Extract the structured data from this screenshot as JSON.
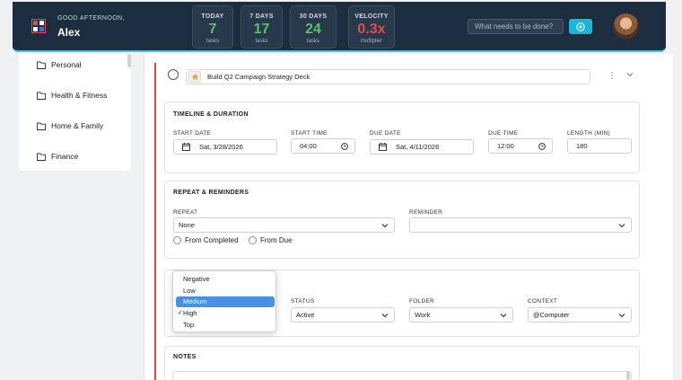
{
  "header": {
    "greeting": "GOOD AFTERNOON,",
    "name": "Alex",
    "search_placeholder": "What needs to be done?",
    "stats": [
      {
        "label": "TODAY",
        "value": "7",
        "sub": "tasks"
      },
      {
        "label": "7 DAYS",
        "value": "17",
        "sub": "tasks"
      },
      {
        "label": "30 DAYS",
        "value": "24",
        "sub": "tasks"
      },
      {
        "label": "VELOCITY",
        "value": "0.3x",
        "sub": "multiplier"
      }
    ],
    "colors": {
      "bar": "#1c2d3f",
      "accent": "#1ab7d9",
      "good": "#56c06c",
      "bad": "#e64b4b"
    }
  },
  "sidebar": {
    "items": [
      {
        "label": "Personal",
        "icon": "folder-icon"
      },
      {
        "label": "Health & Fitness",
        "icon": "folder-icon"
      },
      {
        "label": "Home & Family",
        "icon": "folder-icon"
      },
      {
        "label": "Finance",
        "icon": "folder-icon"
      }
    ]
  },
  "task": {
    "title": "Build Q2 Campaign Strategy Deck"
  },
  "timeline": {
    "title": "TIMELINE & DURATION",
    "start_date_label": "START DATE",
    "start_date": "Sat, 3/28/2026",
    "start_time_label": "START TIME",
    "start_time": "04:00",
    "due_date_label": "DUE DATE",
    "due_date": "Sat, 4/11/2026",
    "due_time_label": "DUE TIME",
    "due_time": "12:00",
    "length_label": "LENGTH (MIN)",
    "length": "180"
  },
  "repeat": {
    "title": "REPEAT & REMINDERS",
    "repeat_label": "REPEAT",
    "repeat_value": "None",
    "reminder_label": "REMINDER",
    "reminder_value": "",
    "from_completed": "From Completed",
    "from_due": "From Due"
  },
  "details": {
    "status_label": "STATUS",
    "status_value": "Active",
    "folder_label": "FOLDER",
    "folder_value": "Work",
    "context_label": "CONTEXT",
    "context_value": "@Computer",
    "priority_options": [
      "Negative",
      "Low",
      "Medium",
      "High",
      "Top"
    ],
    "priority_selected": "High",
    "priority_highlighted": "Medium"
  },
  "notes": {
    "title": "NOTES"
  }
}
